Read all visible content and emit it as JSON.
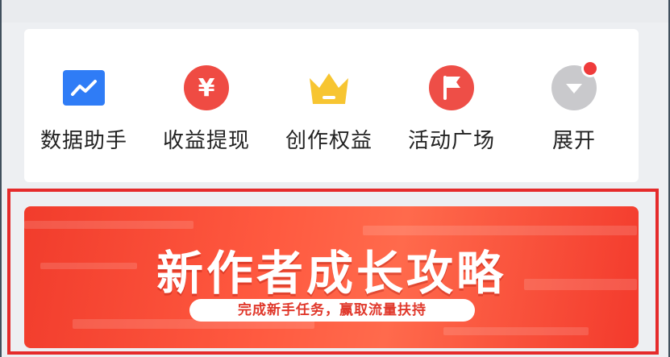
{
  "tools": [
    {
      "label": "数据助手",
      "icon": "chart-trend-icon",
      "color": "#2f7cf6"
    },
    {
      "label": "收益提现",
      "icon": "yen-icon",
      "color": "#ef4b43"
    },
    {
      "label": "创作权益",
      "icon": "crown-icon",
      "color": "#f7c531"
    },
    {
      "label": "活动广场",
      "icon": "flag-icon",
      "color": "#ee4e47"
    },
    {
      "label": "展开",
      "icon": "chevron-down-icon",
      "color": "#c9c9cc",
      "badge": true
    }
  ],
  "banner": {
    "title": "新作者成长攻略",
    "subtitle": "完成新手任务，赢取流量扶持",
    "color": "#f4402f"
  },
  "highlight_color": "#e52b2b"
}
